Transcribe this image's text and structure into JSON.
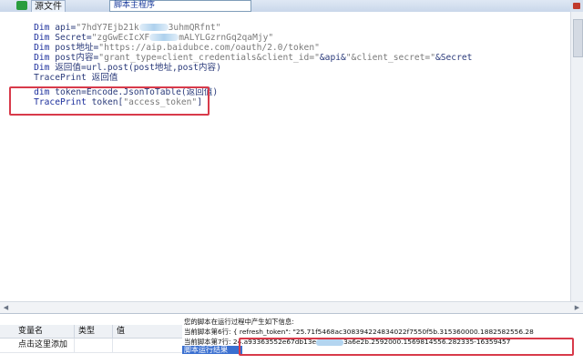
{
  "toolbar": {
    "file_button": "源文件",
    "search_value": "脚本主程序",
    "accent": "#2a9d3e"
  },
  "editor": {
    "lines": {
      "l0": {
        "kw": "Dim ",
        "var": "api=",
        "str_a": "\"7hdY7Ejb21k",
        "str_b": "3uhmQRfnt\""
      },
      "l1": {
        "kw": "Dim ",
        "var": "Secret=",
        "str": "\"zgGwEcIcXF",
        "str_b": "mALYLGzrnGq2qaMjy\""
      },
      "l2": {
        "kw": "Dim ",
        "var": "post地址=",
        "str": "\"https://aip.baidubce.com/oauth/2.0/token\""
      },
      "l3": {
        "kw": "Dim ",
        "var": "post内容=",
        "str": "\"grant_type=client_credentials&client_id=\"",
        "mid": "&api&",
        "str2": "\"&client_secret=\"",
        "end": "&Secret"
      },
      "l4": {
        "kw": "Dim ",
        "var": "返回值=url.post(post地址,post内容)"
      },
      "l5": {
        "text": "TracePrint 返回值"
      },
      "l6": {
        "kw": "dim ",
        "var": "token=Encode.JsonToTable(返回值)"
      },
      "l7": {
        "kw": "TracePrint ",
        "var": "token[",
        "str": "\"access_token\"",
        "end": "]"
      }
    },
    "highlight_color": "#d83a4a"
  },
  "variables": {
    "columns": [
      "变量名",
      "类型",
      "值"
    ],
    "add_row": "点击这里添加"
  },
  "output": {
    "line0": "您的脚本在运行过程中产生如下信息:",
    "line1_prefix": "当前脚本第6行: { refresh_token\": \"25.71f5468ac308394224834022f7550f5b.315360000.1882582556.28",
    "line2_prefix": "当前脚本第7行: 24.a93363552e67db13e",
    "line2_suffix": "3a6e2b.2592000.1569814556.282335-16359457",
    "tab_label": "脚本运行结果"
  }
}
